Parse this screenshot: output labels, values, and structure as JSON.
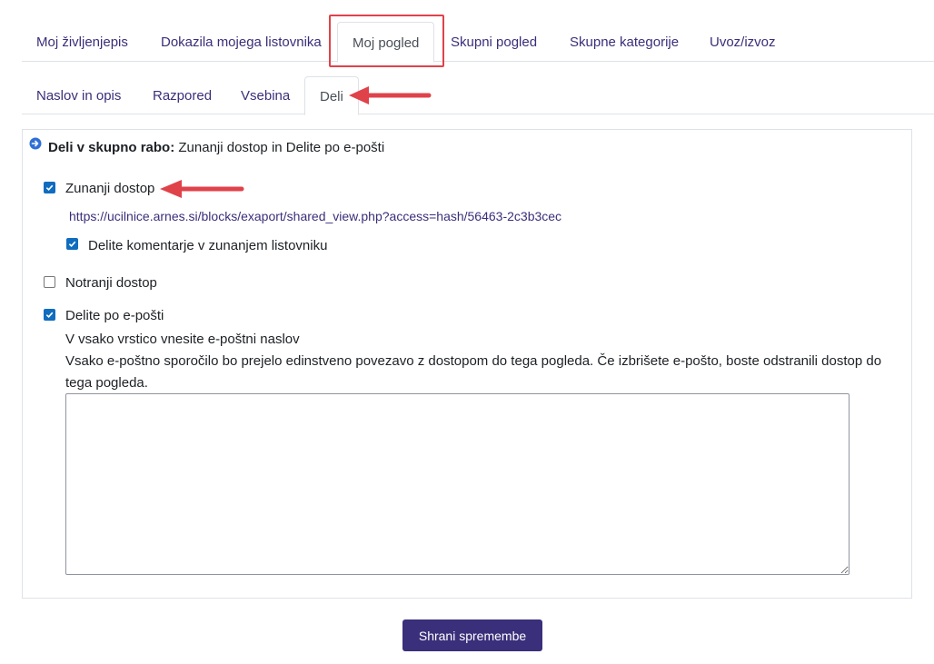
{
  "main_tabs": [
    {
      "label": "Moj življenjepis"
    },
    {
      "label": "Dokazila mojega listovnika"
    },
    {
      "label": "Moj pogled"
    },
    {
      "label": "Skupni pogled"
    },
    {
      "label": "Skupne kategorije"
    },
    {
      "label": "Uvoz/izvoz"
    }
  ],
  "sub_tabs": [
    {
      "label": "Naslov in opis"
    },
    {
      "label": "Razpored"
    },
    {
      "label": "Vsebina"
    },
    {
      "label": "Deli"
    }
  ],
  "share": {
    "heading_bold": "Deli v skupno rabo:",
    "heading_text": "Zunanji dostop in Delite po e-pošti",
    "external": {
      "label": "Zunanji dostop",
      "checked": true,
      "url": "https://ucilnice.arnes.si/blocks/exaport/shared_view.php?access=hash/56463-2c3b3cec",
      "comments_label": "Delite komentarje v zunanjem listovniku",
      "comments_checked": true
    },
    "internal": {
      "label": "Notranji dostop",
      "checked": false
    },
    "email": {
      "label": "Delite po e-pošti",
      "checked": true,
      "hint": "V vsako vrstico vnesite e-poštni naslov",
      "description_line1": "Vsako e-poštno sporočilo bo prejelo edinstveno povezavo z dostopom do tega pogleda. Če izbrišete e-pošto, boste odstranili dostop do",
      "description_line2": "tega pogleda."
    }
  },
  "save_button": "Shrani spremembe",
  "colors": {
    "accent": "#3a2f7a",
    "checkbox": "#0f6cbf",
    "annotation": "#e0424a"
  }
}
